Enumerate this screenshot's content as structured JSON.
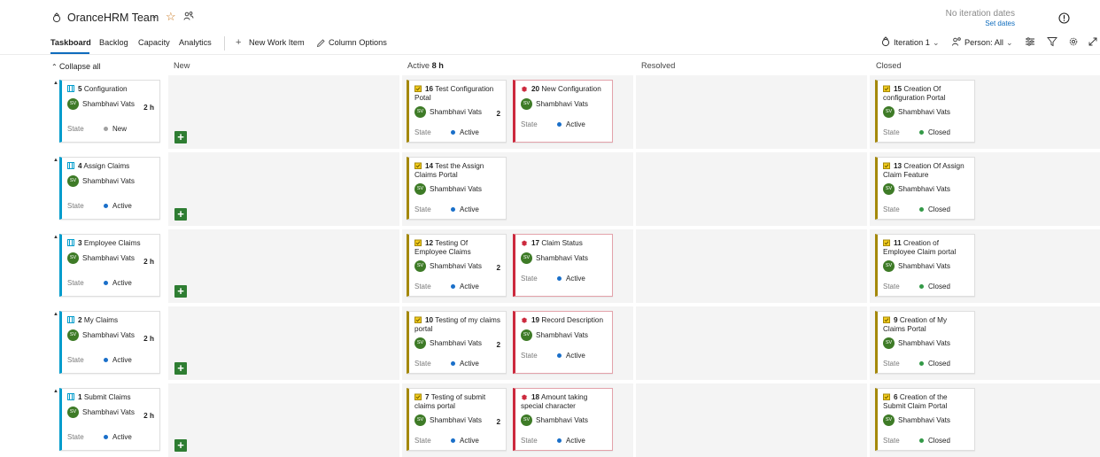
{
  "header": {
    "team_name": "OranceHRM Team",
    "iteration_dates": "No iteration dates",
    "set_dates": "Set dates"
  },
  "tabs": [
    {
      "label": "Taskboard",
      "active": true
    },
    {
      "label": "Backlog"
    },
    {
      "label": "Capacity"
    },
    {
      "label": "Analytics"
    }
  ],
  "toolbar": {
    "new_work_item": "New Work Item",
    "column_options": "Column Options",
    "iteration": "Iteration 1",
    "person": "Person: All"
  },
  "columns": {
    "collapse_all": "Collapse all",
    "new": "New",
    "active": "Active",
    "active_hours": "8 h",
    "resolved": "Resolved",
    "closed": "Closed"
  },
  "labels": {
    "state": "State",
    "initials": "SV"
  },
  "colors": {
    "story": "#009ccc",
    "task": "#a4880a",
    "bug": "#cc293d",
    "new": "#a0a0a0",
    "active": "#1a6fc9",
    "closed": "#339947",
    "avatar": "#3e7b27",
    "accent": "#0f6cbd"
  },
  "rows": [
    {
      "story": {
        "id": "5",
        "title": "Configuration",
        "assignee": "Shambhavi Vats",
        "remaining": "2 h",
        "state": "New"
      },
      "active": [
        {
          "id": "16",
          "title": "Test Configuration Potal",
          "assignee": "Shambhavi Vats",
          "remaining": "2",
          "state": "Active",
          "type": "task"
        },
        {
          "id": "20",
          "title": "New Configuration",
          "assignee": "Shambhavi Vats",
          "remaining": "",
          "state": "Active",
          "type": "bug"
        }
      ],
      "closed": [
        {
          "id": "15",
          "title": "Creation Of configuration Portal",
          "assignee": "Shambhavi Vats",
          "state": "Closed",
          "type": "task"
        }
      ]
    },
    {
      "story": {
        "id": "4",
        "title": "Assign Claims",
        "assignee": "Shambhavi Vats",
        "remaining": "",
        "state": "Active"
      },
      "active": [
        {
          "id": "14",
          "title": "Test the Assign Claims Portal",
          "assignee": "Shambhavi Vats",
          "remaining": "",
          "state": "Active",
          "type": "task"
        }
      ],
      "closed": [
        {
          "id": "13",
          "title": "Creation Of Assign Claim Feature",
          "assignee": "Shambhavi Vats",
          "state": "Closed",
          "type": "task"
        }
      ]
    },
    {
      "story": {
        "id": "3",
        "title": "Employee Claims",
        "assignee": "Shambhavi Vats",
        "remaining": "2 h",
        "state": "Active"
      },
      "active": [
        {
          "id": "12",
          "title": "Testing Of Employee Claims",
          "assignee": "Shambhavi Vats",
          "remaining": "2",
          "state": "Active",
          "type": "task"
        },
        {
          "id": "17",
          "title": "Claim Status",
          "assignee": "Shambhavi Vats",
          "remaining": "",
          "state": "Active",
          "type": "bug"
        }
      ],
      "closed": [
        {
          "id": "11",
          "title": "Creation of Employee Claim portal",
          "assignee": "Shambhavi Vats",
          "state": "Closed",
          "type": "task"
        }
      ]
    },
    {
      "story": {
        "id": "2",
        "title": "My Claims",
        "assignee": "Shambhavi Vats",
        "remaining": "2 h",
        "state": "Active"
      },
      "active": [
        {
          "id": "10",
          "title": "Testing of my claims portal",
          "assignee": "Shambhavi Vats",
          "remaining": "2",
          "state": "Active",
          "type": "task"
        },
        {
          "id": "19",
          "title": "Record Description",
          "assignee": "Shambhavi Vats",
          "remaining": "",
          "state": "Active",
          "type": "bug"
        }
      ],
      "closed": [
        {
          "id": "9",
          "title": "Creation of My Claims Portal",
          "assignee": "Shambhavi Vats",
          "state": "Closed",
          "type": "task"
        }
      ]
    },
    {
      "story": {
        "id": "1",
        "title": "Submit Claims",
        "assignee": "Shambhavi Vats",
        "remaining": "2 h",
        "state": "Active"
      },
      "active": [
        {
          "id": "7",
          "title": "Testing of submit claims portal",
          "assignee": "Shambhavi Vats",
          "remaining": "2",
          "state": "Active",
          "type": "task"
        },
        {
          "id": "18",
          "title": "Amount taking special character",
          "assignee": "Shambhavi Vats",
          "remaining": "",
          "state": "Active",
          "type": "bug"
        }
      ],
      "closed": [
        {
          "id": "6",
          "title": "Creation of the Submit Claim Portal",
          "assignee": "Shambhavi Vats",
          "state": "Closed",
          "type": "task"
        }
      ]
    }
  ]
}
